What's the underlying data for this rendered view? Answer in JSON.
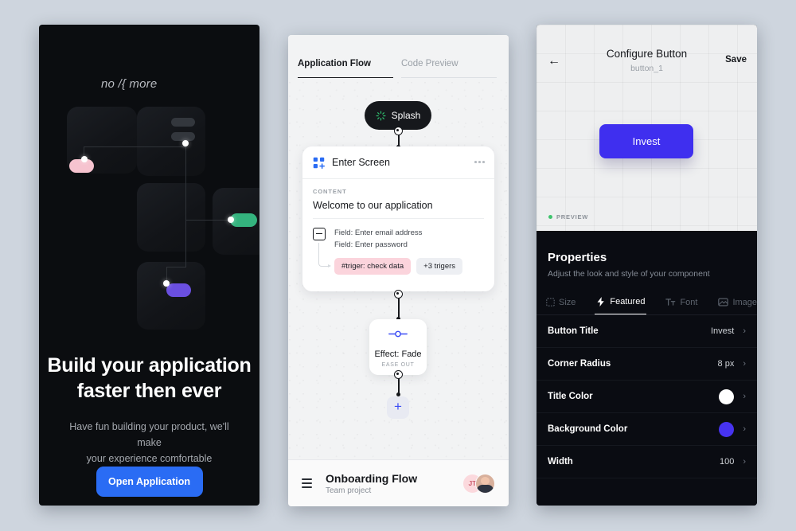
{
  "hero": {
    "logo": "no /{ more",
    "title_line1": "Build your application",
    "title_line2": "faster then ever",
    "subtitle_line1": "Have fun building your product, we'll make",
    "subtitle_line2": "your experience comfortable",
    "cta_label": "Open Application",
    "cta_color": "#2a6cf4",
    "pill_pink": "#f6c3cf",
    "pill_green": "#34b37e",
    "pill_purple": "#6a4fe0"
  },
  "flow": {
    "tabs": [
      {
        "label": "Application Flow",
        "active": true
      },
      {
        "label": "Code Preview",
        "active": false
      }
    ],
    "splash_node": {
      "label": "Splash",
      "icon": "loading-spinner-icon",
      "icon_color": "#2fbf6e"
    },
    "screen_card": {
      "title": "Enter Screen",
      "icon": "grid-plus-icon",
      "icon_color": "#2a6cf4",
      "section_label": "CONTENT",
      "content_text": "Welcome to our application",
      "fields": [
        "Field: Enter email address",
        "Field: Enter password"
      ],
      "tags": [
        {
          "label": "#triger: check data",
          "style": "pink"
        },
        {
          "label": "+3 trigers",
          "style": "grey"
        }
      ]
    },
    "effect_card": {
      "title": "Effect: Fade",
      "easing": "EASE OUT",
      "icon": "slider-node-icon"
    },
    "add_button": "+",
    "footer": {
      "icon": "list-icon",
      "title": "Onboarding Flow",
      "subtitle": "Team project",
      "avatars": [
        {
          "type": "initials",
          "label": "JT"
        },
        {
          "type": "photo",
          "label": ""
        }
      ]
    }
  },
  "config": {
    "back_icon": "arrow-left-icon",
    "title": "Configure Button",
    "subtitle": "button_1",
    "save_label": "Save",
    "preview_button_label": "Invest",
    "preview_button_color": "#3f2fef",
    "preview_badge": "PREVIEW",
    "preview_badge_color": "#3ec46d",
    "properties_title": "Properties",
    "properties_subtitle": "Adjust the look and style of your component",
    "tabs": [
      {
        "label": "Size",
        "icon": "dotted-square-icon",
        "active": false
      },
      {
        "label": "Featured",
        "icon": "lightning-bolt-icon",
        "active": true
      },
      {
        "label": "Font",
        "icon": "text-format-icon",
        "active": false
      },
      {
        "label": "Image",
        "icon": "image-icon",
        "active": false
      }
    ],
    "rows": [
      {
        "key": "Button Title",
        "value": "Invest",
        "type": "text"
      },
      {
        "key": "Corner Radius",
        "value": "8 px",
        "type": "text"
      },
      {
        "key": "Title Color",
        "value": "#ffffff",
        "type": "color"
      },
      {
        "key": "Background Color",
        "value": "#4733f0",
        "type": "color"
      },
      {
        "key": "Width",
        "value": "100",
        "type": "text"
      }
    ],
    "chevron": "›"
  }
}
